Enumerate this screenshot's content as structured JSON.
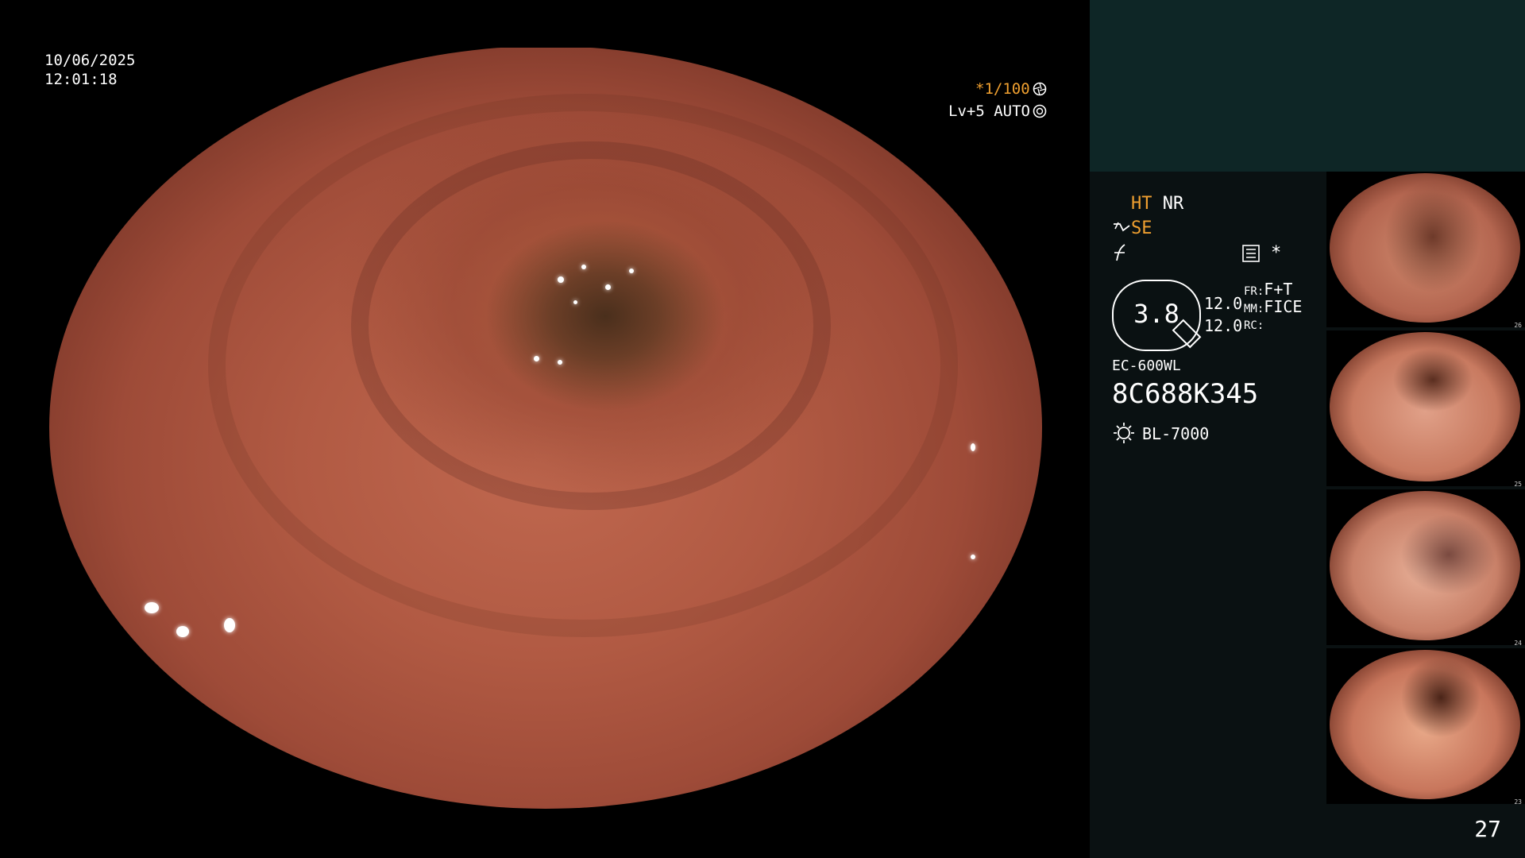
{
  "overlay": {
    "date": "10/06/2025",
    "time": "12:01:18",
    "shutter": "*1/100",
    "level": "Lv+5 AUTO"
  },
  "panel": {
    "ht": "HT",
    "nr": "NR",
    "se": "SE",
    "star": "*",
    "zoom_value": "3.8",
    "val1": "12.0",
    "val2": "12.0",
    "fr_label": "FR:",
    "fr_value": "F+T",
    "mm_label": "MM:",
    "mm_value": "FICE",
    "rc_label": "RC:",
    "scope_model": "EC-600WL",
    "scope_serial": "8C688K345",
    "light_source": "BL-7000",
    "page_number": "27"
  },
  "thumbnails": [
    {
      "number": "26"
    },
    {
      "number": "25"
    },
    {
      "number": "24"
    },
    {
      "number": "23"
    }
  ],
  "colors": {
    "accent_orange": "#f0a030",
    "panel_bg": "#0a1112",
    "panel_top_bg": "#0e2626"
  }
}
